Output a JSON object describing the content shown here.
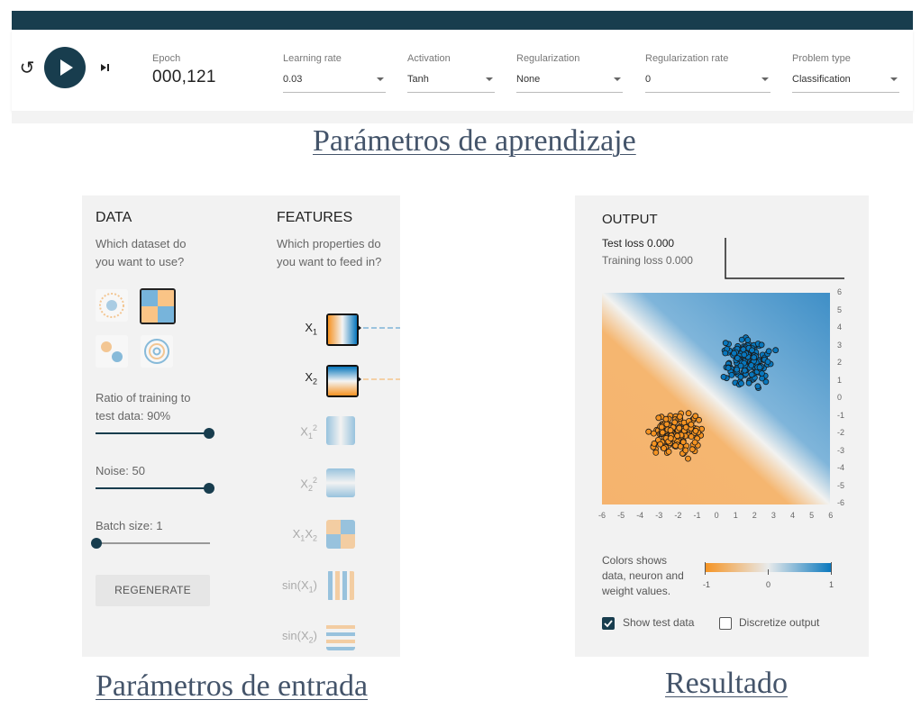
{
  "toolbar": {
    "epoch_label": "Epoch",
    "epoch_value": "000,121",
    "learning_rate_label": "Learning rate",
    "learning_rate_value": "0.03",
    "activation_label": "Activation",
    "activation_value": "Tanh",
    "regularization_label": "Regularization",
    "regularization_value": "None",
    "regularization_rate_label": "Regularization rate",
    "regularization_rate_value": "0",
    "problem_type_label": "Problem type",
    "problem_type_value": "Classification",
    "reset_icon": "reset-icon",
    "play_icon": "play-icon",
    "step_icon": "step-forward-icon",
    "accent": "#183d4e"
  },
  "captions": {
    "learning_params": "Parámetros de aprendizaje",
    "input_params": "Parámetros de entrada",
    "result": "Resultado"
  },
  "data_panel": {
    "title": "DATA",
    "question_line1": "Which dataset do",
    "question_line2": "you want to use?",
    "datasets": [
      "circle",
      "xor",
      "gaussian",
      "spiral"
    ],
    "selected_dataset": "xor",
    "ratio_label_line1": "Ratio of training to",
    "ratio_label_line2": "test data:  90%",
    "ratio_value": 0.9,
    "noise_label": "Noise:  50",
    "noise_value": 1.0,
    "batch_label": "Batch size:  1",
    "batch_value": 0.0,
    "regenerate_label": "REGENERATE"
  },
  "features_panel": {
    "title": "FEATURES",
    "question_line1": "Which properties do",
    "question_line2": "you want to feed in?",
    "features": [
      {
        "label": "X",
        "sub": "1",
        "sup": "",
        "active": true
      },
      {
        "label": "X",
        "sub": "2",
        "sup": "",
        "active": true
      },
      {
        "label": "X",
        "sub": "1",
        "sup": "2",
        "active": false
      },
      {
        "label": "X",
        "sub": "2",
        "sup": "2",
        "active": false
      },
      {
        "label": "X",
        "sub": "1",
        "sup": "",
        "extra": "X",
        "extra_sub": "2",
        "active": false
      },
      {
        "label": "sin(X",
        "sub": "1",
        "suffix": ")",
        "active": false
      },
      {
        "label": "sin(X",
        "sub": "2",
        "suffix": ")",
        "active": false
      }
    ]
  },
  "output_panel": {
    "title": "OUTPUT",
    "test_loss": "Test loss 0.000",
    "training_loss": "Training loss 0.000",
    "x_ticks": [
      "-6",
      "-5",
      "-4",
      "-3",
      "-2",
      "-1",
      "0",
      "1",
      "2",
      "3",
      "4",
      "5",
      "6"
    ],
    "y_ticks": [
      "6",
      "5",
      "4",
      "3",
      "2",
      "1",
      "0",
      "-1",
      "-2",
      "-3",
      "-4",
      "-5",
      "-6"
    ],
    "legend_line1": "Colors shows",
    "legend_line2": "data, neuron and",
    "legend_line3": "weight values.",
    "legend_min": "-1",
    "legend_mid": "0",
    "legend_max": "1",
    "show_test_data_label": "Show test data",
    "show_test_data": true,
    "discretize_label": "Discretize output",
    "discretize": false,
    "colors": {
      "positive": "#0877bd",
      "negative": "#f59322"
    }
  }
}
